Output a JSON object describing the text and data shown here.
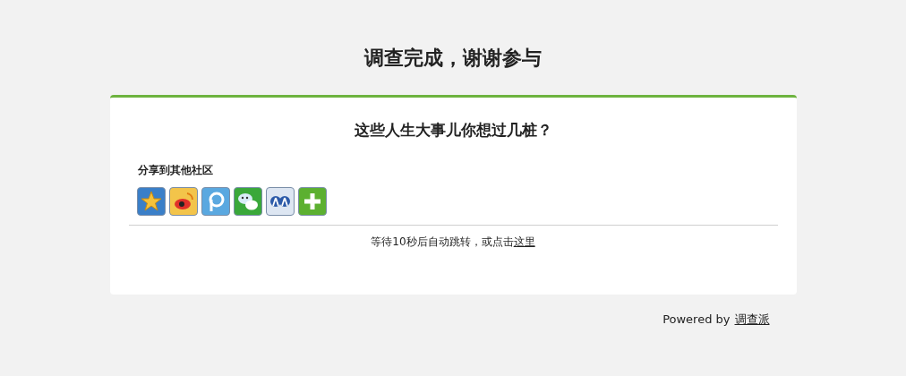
{
  "page_title": "调查完成，谢谢参与",
  "card": {
    "heading": "这些人生大事儿你想过几桩？",
    "share": {
      "label": "分享到其他社区",
      "icons": [
        {
          "kind": "star"
        },
        {
          "kind": "eye"
        },
        {
          "kind": "p"
        },
        {
          "kind": "chat"
        },
        {
          "kind": "people"
        },
        {
          "kind": "plus"
        }
      ]
    },
    "redirect": {
      "text": "等待10秒后自动跳转，或点击",
      "link": "这里"
    }
  },
  "footer": {
    "text": "Powered by",
    "link": "调查派"
  }
}
